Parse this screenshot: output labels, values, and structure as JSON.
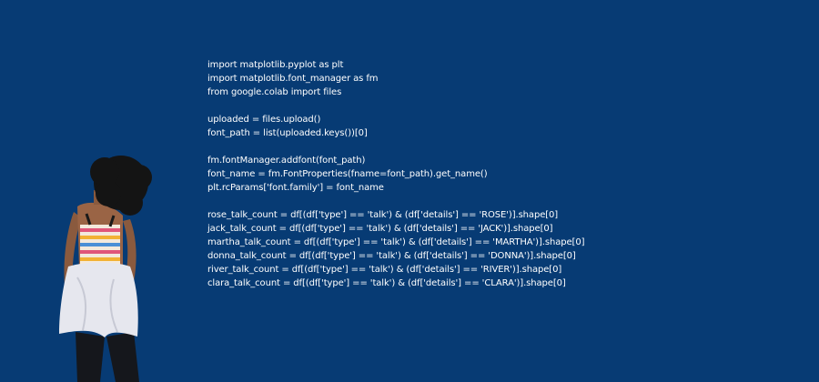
{
  "code": {
    "lines": [
      "import matplotlib.pyplot as plt",
      "import matplotlib.font_manager as fm",
      "from google.colab import files",
      "",
      "uploaded = files.upload()",
      "font_path = list(uploaded.keys())[0]",
      "",
      "fm.fontManager.addfont(font_path)",
      "font_name = fm.FontProperties(fname=font_path).get_name()",
      "plt.rcParams['font.family'] = font_name",
      "",
      "rose_talk_count = df[(df['type'] == 'talk') & (df['details'] == 'ROSE')].shape[0]",
      "jack_talk_count = df[(df['type'] == 'talk') & (df['details'] == 'JACK')].shape[0]",
      "martha_talk_count = df[(df['type'] == 'talk') & (df['details'] == 'MARTHA')].shape[0]",
      "donna_talk_count = df[(df['type'] == 'talk') & (df['details'] == 'DONNA')].shape[0]",
      "river_talk_count = df[(df['type'] == 'talk') & (df['details'] == 'RIVER')].shape[0]",
      "clara_talk_count = df[(df['type'] == 'talk') & (df['details'] == 'CLARA')].shape[0]"
    ]
  },
  "colors": {
    "background": "#073b74",
    "text": "#ffffff"
  }
}
